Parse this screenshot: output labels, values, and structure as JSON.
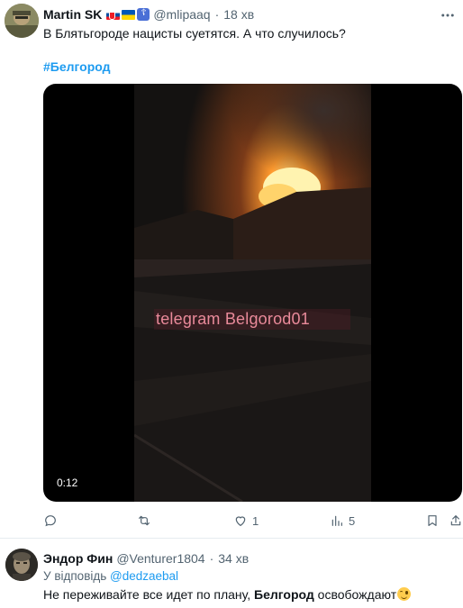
{
  "main_tweet": {
    "display_name": "Martin SK",
    "handle": "@mlipaaq",
    "dot": "·",
    "time": "18 хв",
    "flags": [
      "slovakia-flag-icon",
      "ukraine-flag-icon",
      "orthodox-cross-icon"
    ],
    "text": "В Блятьгороде нацисты суетятся. А что случилось?",
    "hashtag": "#Белгород",
    "video": {
      "duration": "0:12",
      "watermark": "telegram Belgorod01"
    },
    "actions": {
      "reply_count": "",
      "retweet_count": "",
      "like_count": "1",
      "views_count": "5"
    }
  },
  "reply_tweet": {
    "display_name": "Эндор Фин",
    "handle": "@Venturer1804",
    "dot": "·",
    "time": "34 хв",
    "reply_prefix": "У відповідь",
    "reply_mention": "@dedzaebal",
    "text_before": "Не переживайте все идет по плану, ",
    "text_bold": "Белгород",
    "text_after": " освобождают"
  },
  "colors": {
    "accent": "#1d9bf0",
    "secondary_text": "#536471",
    "primary_text": "#0f1419"
  }
}
